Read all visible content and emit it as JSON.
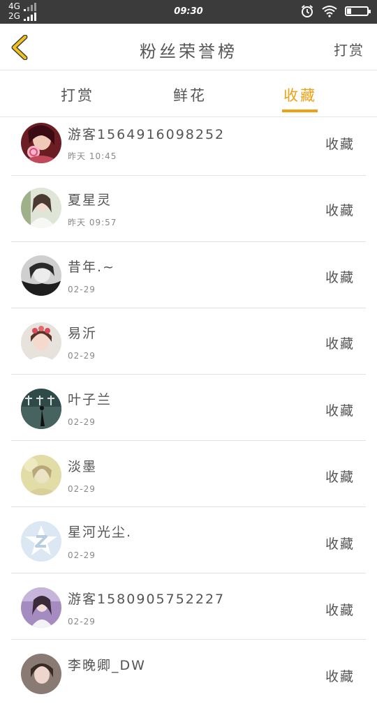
{
  "status_bar": {
    "network_top": "4G",
    "network_bottom": "2G",
    "time": "09:30"
  },
  "header": {
    "title": "粉丝荣誉榜",
    "action_label": "打赏"
  },
  "tabs": [
    {
      "label": "打赏",
      "active": false
    },
    {
      "label": "鲜花",
      "active": false
    },
    {
      "label": "收藏",
      "active": true
    }
  ],
  "accent_color": "#f0a010",
  "list": [
    {
      "name": "游客1564916098252",
      "time": "昨天 10:45",
      "action": "收藏",
      "avatar_icon": "girl-lollipop-avatar"
    },
    {
      "name": "夏星灵",
      "time": "昨天 09:57",
      "action": "收藏",
      "avatar_icon": "girl-white-avatar"
    },
    {
      "name": "昔年.~",
      "time": "02-29",
      "action": "收藏",
      "avatar_icon": "girl-bw-avatar"
    },
    {
      "name": "易沂",
      "time": "02-29",
      "action": "收藏",
      "avatar_icon": "girl-flower-avatar"
    },
    {
      "name": "叶子兰",
      "time": "02-29",
      "action": "收藏",
      "avatar_icon": "dark-scene-avatar"
    },
    {
      "name": "淡墨",
      "time": "02-29",
      "action": "收藏",
      "avatar_icon": "faded-girl-avatar"
    },
    {
      "name": "星河光尘.",
      "time": "02-29",
      "action": "收藏",
      "avatar_icon": "default-z-avatar"
    },
    {
      "name": "游客1580905752227",
      "time": "02-29",
      "action": "收藏",
      "avatar_icon": "girl-purple-avatar"
    },
    {
      "name": "李晚卿_DW",
      "time": "",
      "action": "收藏",
      "avatar_icon": "girl-partial-avatar"
    }
  ]
}
